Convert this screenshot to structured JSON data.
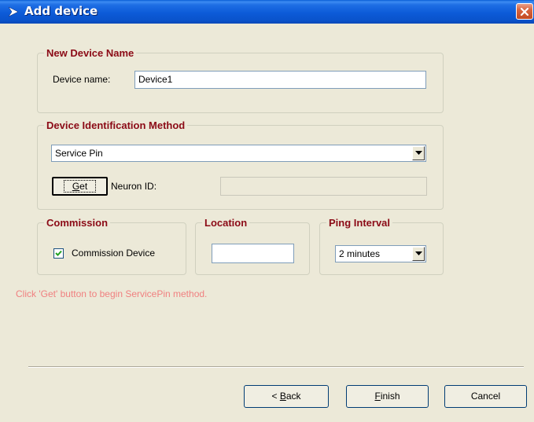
{
  "window": {
    "title": "Add device",
    "title_icon": "arrow-icon",
    "close_icon": "close-icon"
  },
  "new_device": {
    "legend": "New Device Name",
    "name_label": "Device name:",
    "name_value": "Device1"
  },
  "identification": {
    "legend": "Device Identification Method",
    "method_selected": "Service Pin",
    "get_label_pre": "",
    "get_label_mnemonic": "G",
    "get_label_post": "et",
    "neuron_id_label": "Neuron ID:",
    "neuron_id_value": ""
  },
  "commission": {
    "legend": "Commission",
    "checkbox_label": "Commission Device",
    "checked": true
  },
  "location": {
    "legend": "Location",
    "value": ""
  },
  "ping": {
    "legend": "Ping Interval",
    "selected": "2 minutes"
  },
  "hint": "Click 'Get' button to begin ServicePin method.",
  "footer": {
    "back_prefix": "< ",
    "back_mnemonic": "B",
    "back_rest": "ack",
    "finish_mnemonic": "F",
    "finish_rest": "inish",
    "cancel_label": "Cancel"
  },
  "colors": {
    "legend": "#8b0a16",
    "hint": "#f08080",
    "titlebar": "#0a53cc"
  }
}
